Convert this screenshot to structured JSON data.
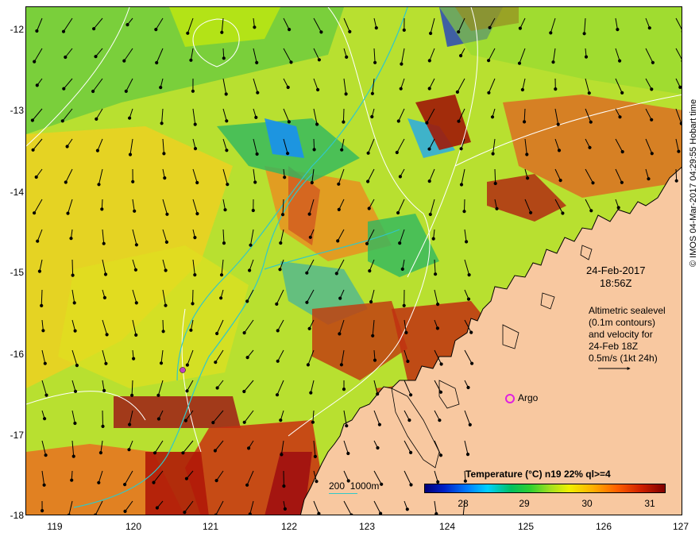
{
  "map": {
    "latitude_labels": [
      "-12",
      "-13",
      "-14",
      "-15",
      "-16",
      "-17",
      "-18"
    ],
    "longitude_labels": [
      "119",
      "120",
      "121",
      "122",
      "123",
      "124",
      "125",
      "126",
      "127"
    ],
    "lat_range": [
      -18,
      -11.97
    ],
    "lon_range": [
      118.65,
      127
    ],
    "land_color": "#f8c8a0",
    "ocean_color_dominant": "#b8e030",
    "vector_color": "#000000",
    "contour_color": "#ffffff",
    "isobath_color": "#30c8c8"
  },
  "annotations": {
    "date": "24-Feb-2017",
    "time": "18:56Z",
    "altimetry_lines": [
      "Altimetric sealevel",
      "(0.1m contours)",
      "and velocity for",
      "24-Feb 18Z",
      "0.5m/s (1kt 24h)"
    ],
    "argo_label": "Argo",
    "argo_marker_color": "#e020e0"
  },
  "legend": {
    "title": "Temperature (°C) n19 22% ql>=4",
    "ticks": [
      "28",
      "29",
      "30",
      "31"
    ],
    "colors": [
      "#00007a",
      "#0080ff",
      "#00c060",
      "#a0e020",
      "#f0f000",
      "#ffb000",
      "#ff6000",
      "#800000"
    ]
  },
  "depth_key": {
    "label_200": "200",
    "label_1000": "1000m"
  },
  "credit": "© IMOS 04-Mar-2017 04:29:55 Hobart time"
}
